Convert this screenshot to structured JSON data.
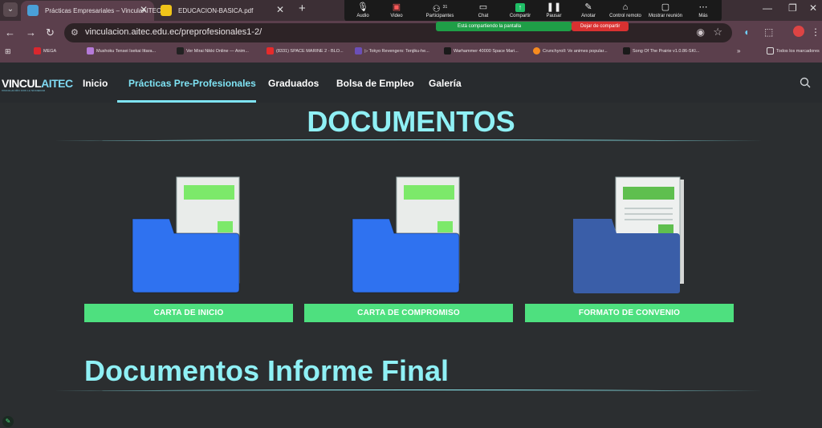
{
  "browser": {
    "tabs": [
      {
        "title": "Prácticas Empresariales – VinculaAITEC",
        "active": true
      },
      {
        "title": "EDUCACION-BASICA.pdf",
        "active": false
      }
    ],
    "address": "vinculacion.aitec.edu.ec/preprofesionales1-2/",
    "bookmarks": [
      "MEGA",
      "Mushoku Tensei Isekai Ittara...",
      "Ver Mirai Nikki Online — Anim...",
      "(8331) SPACE MARINE 2 - BLO...",
      "▷ Tokyo Revengers: Tenjiku-he...",
      "Warhammer 40000 Space Mari...",
      "Crunchyroll: Ve animes popular...",
      "Song Of The Prairie v1.0.86-SKI..."
    ],
    "bookmarks_all": "Todos los marcadores"
  },
  "meeting": {
    "items": [
      {
        "label": "Audio",
        "icon": "microphone-icon"
      },
      {
        "label": "Video",
        "icon": "video-off-icon"
      },
      {
        "label": "Participantes",
        "icon": "participants-icon"
      },
      {
        "label": "Chat",
        "icon": "chat-icon"
      },
      {
        "label": "Compartir",
        "icon": "share-screen-icon"
      },
      {
        "label": "Pausar",
        "icon": "pause-icon"
      },
      {
        "label": "Anotar",
        "icon": "annotate-icon"
      },
      {
        "label": "Control remoto",
        "icon": "remote-control-icon"
      },
      {
        "label": "Mostrar reunión",
        "icon": "show-meeting-icon"
      },
      {
        "label": "Más",
        "icon": "more-icon"
      }
    ],
    "participants_count": "31",
    "sharing_status": "Está compartiendo la pantalla",
    "stop_sharing": "Dejar de compartir"
  },
  "site": {
    "logo": "VINCUL",
    "logo_accent": "AITEC",
    "logo_sub": "VINCULACIÓN CON LA SOCIEDAD",
    "nav": [
      "Inicio",
      "Prácticas Pre-Profesionales",
      "Graduados",
      "Bolsa de Empleo",
      "Galería"
    ],
    "active_nav": "Prácticas Pre-Profesionales"
  },
  "main": {
    "heading": "DOCUMENTOS",
    "documents": [
      {
        "label": "CARTA DE INICIO",
        "folder_color": "#2f72f0"
      },
      {
        "label": "CARTA DE COMPROMISO",
        "folder_color": "#2f72f0"
      },
      {
        "label": "FORMATO DE CONVENIO",
        "folder_color": "#3a5ea8"
      }
    ],
    "heading2": "Documentos Informe Final"
  },
  "colors": {
    "accent": "#8ff0f5",
    "button": "#4ee07f",
    "nav_active": "#7fe3f4",
    "browser_chrome": "#5b3f4c"
  }
}
